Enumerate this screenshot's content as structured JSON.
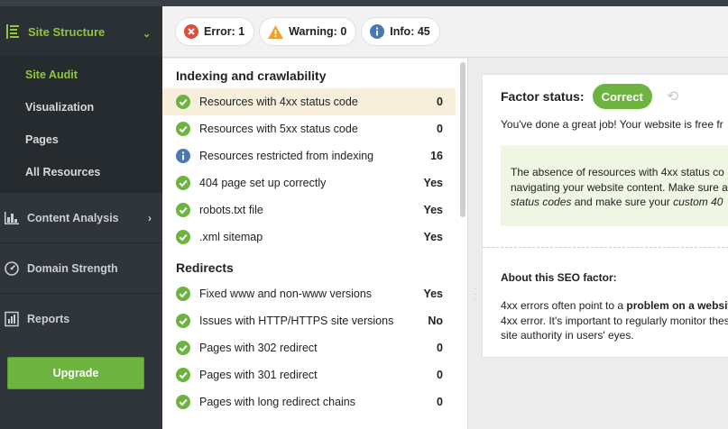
{
  "sidebar": {
    "section_title": "Site Structure",
    "sub_items": [
      {
        "label": "Site Audit",
        "active": true
      },
      {
        "label": "Visualization"
      },
      {
        "label": "Pages"
      },
      {
        "label": "All Resources"
      }
    ],
    "sections": [
      {
        "label": "Content Analysis",
        "icon": "bar-chart-icon",
        "has_arrow": true
      },
      {
        "label": "Domain Strength",
        "icon": "gauge-icon"
      },
      {
        "label": "Reports",
        "icon": "report-icon"
      }
    ],
    "upgrade_label": "Upgrade"
  },
  "filters": [
    {
      "label": "Error: 1",
      "icon": "error-icon",
      "color": "#e04b3a"
    },
    {
      "label": "Warning: 0",
      "icon": "warning-icon",
      "color": "#f0a030"
    },
    {
      "label": "Info: 45",
      "icon": "info-icon",
      "color": "#4a78b5"
    }
  ],
  "groups": [
    {
      "title": "Indexing and crawlability",
      "rows": [
        {
          "text": "Resources with 4xx status code",
          "value": "0",
          "status": "ok",
          "selected": true
        },
        {
          "text": "Resources with 5xx status code",
          "value": "0",
          "status": "ok"
        },
        {
          "text": "Resources restricted from indexing",
          "value": "16",
          "status": "info"
        },
        {
          "text": "404 page set up correctly",
          "value": "Yes",
          "status": "ok"
        },
        {
          "text": "robots.txt file",
          "value": "Yes",
          "status": "ok"
        },
        {
          "text": ".xml sitemap",
          "value": "Yes",
          "status": "ok"
        }
      ]
    },
    {
      "title": "Redirects",
      "rows": [
        {
          "text": "Fixed www and non-www versions",
          "value": "Yes",
          "status": "ok"
        },
        {
          "text": "Issues with HTTP/HTTPS site versions",
          "value": "No",
          "status": "ok"
        },
        {
          "text": "Pages with 302 redirect",
          "value": "0",
          "status": "ok"
        },
        {
          "text": "Pages with 301 redirect",
          "value": "0",
          "status": "ok"
        },
        {
          "text": "Pages with long redirect chains",
          "value": "0",
          "status": "ok"
        }
      ]
    }
  ],
  "detail": {
    "factor_status_label": "Factor status:",
    "status_badge": "Correct",
    "summary": "You've done a great job! Your website is free fr",
    "box_line1": "The absence of resources with 4xx status co",
    "box_line2": "navigating your website content. Make sure a",
    "box_line3_italic": "status codes",
    "box_line3_rest": " and make sure your ",
    "box_line3_italic2": "custom 40",
    "about_title": "About this SEO factor:",
    "about_line1_start": "4xx errors often point to a ",
    "about_line1_bold": "problem on a websit",
    "about_line2": "4xx error. It's important to regularly monitor thes",
    "about_line3": "site authority in users' eyes."
  },
  "colors": {
    "accent_green": "#8dc63f",
    "ok_green": "#6db33f",
    "sidebar_bg": "#2f353b",
    "selected_row": "#f7efdc"
  }
}
